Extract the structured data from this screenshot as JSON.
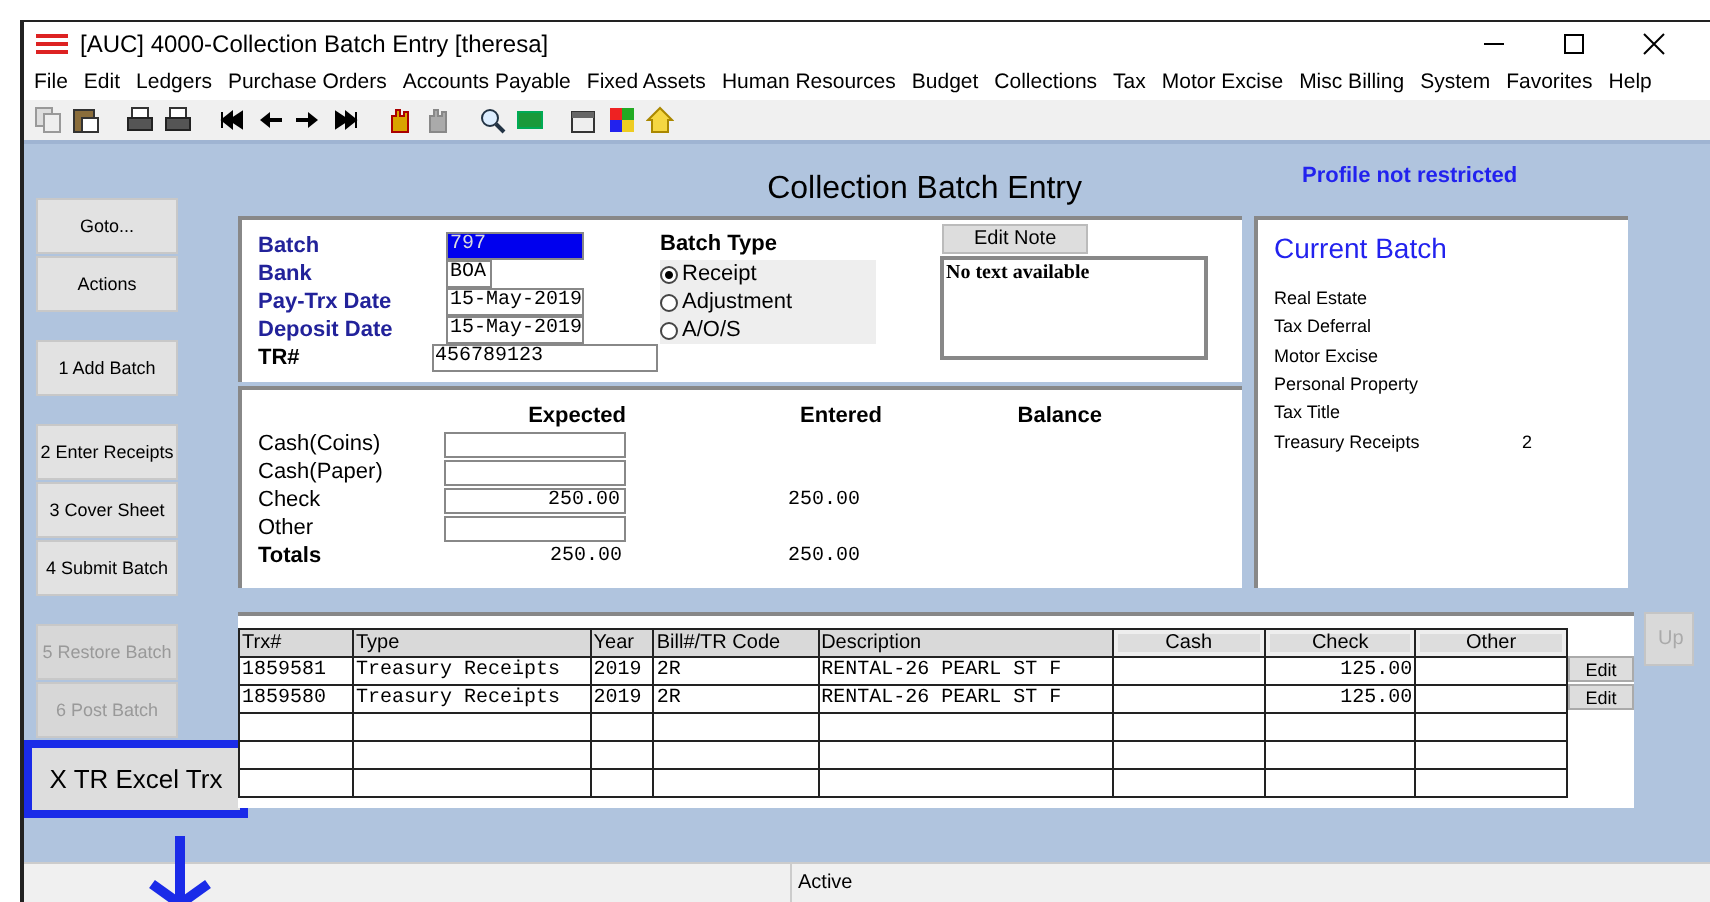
{
  "window": {
    "title": "[AUC] 4000-Collection Batch Entry [theresa]"
  },
  "menu": [
    "File",
    "Edit",
    "Ledgers",
    "Purchase Orders",
    "Accounts Payable",
    "Fixed Assets",
    "Human Resources",
    "Budget",
    "Collections",
    "Tax",
    "Motor Excise",
    "Misc Billing",
    "System",
    "Favorites",
    "Help"
  ],
  "header": {
    "title": "Collection Batch Entry",
    "profile": "Profile not restricted"
  },
  "left_buttons": [
    {
      "label": "Goto...",
      "disabled": false,
      "highlighted": false
    },
    {
      "label": "Actions",
      "disabled": false,
      "highlighted": false
    },
    {
      "label": "1 Add Batch",
      "disabled": false,
      "highlighted": false
    },
    {
      "label": "2 Enter Receipts",
      "disabled": false,
      "highlighted": false
    },
    {
      "label": "3 Cover Sheet",
      "disabled": false,
      "highlighted": false
    },
    {
      "label": "4 Submit Batch",
      "disabled": false,
      "highlighted": false
    },
    {
      "label": "5 Restore Batch",
      "disabled": true,
      "highlighted": false
    },
    {
      "label": "6 Post Batch",
      "disabled": true,
      "highlighted": false
    },
    {
      "label": "X TR Excel Trx",
      "disabled": false,
      "highlighted": true
    }
  ],
  "batch_fields": [
    {
      "label": "Batch",
      "value": "797",
      "focused": true,
      "kind": "short"
    },
    {
      "label": "Bank",
      "value": "BOA",
      "focused": false,
      "kind": "tiny"
    },
    {
      "label": "Pay-Trx Date",
      "value": "15-May-2019",
      "focused": false,
      "kind": "short"
    },
    {
      "label": "Deposit Date",
      "value": "15-May-2019",
      "focused": false,
      "kind": "short"
    },
    {
      "label": "TR#",
      "value": "456789123",
      "focused": false,
      "kind": "long"
    }
  ],
  "batch_type": {
    "label": "Batch Type",
    "options": [
      {
        "label": "Receipt",
        "selected": true
      },
      {
        "label": "Adjustment",
        "selected": false
      },
      {
        "label": "A/O/S",
        "selected": false
      }
    ]
  },
  "note": {
    "button": "Edit Note",
    "text": "No text available"
  },
  "amounts": {
    "columns": [
      "Expected",
      "Entered",
      "Balance"
    ],
    "rows": [
      {
        "label": "Cash(Coins)",
        "expected": "",
        "entered": "",
        "kind": "input"
      },
      {
        "label": "Cash(Paper)",
        "expected": "",
        "entered": "",
        "kind": "input"
      },
      {
        "label": "Check",
        "expected": "250.00",
        "entered": "250.00",
        "kind": "input"
      },
      {
        "label": "Other",
        "expected": "",
        "entered": "",
        "kind": "input"
      },
      {
        "label": "Totals",
        "expected": "250.00",
        "entered": "250.00",
        "kind": "total"
      }
    ]
  },
  "current_batch": {
    "title": "Current Batch",
    "items": [
      {
        "label": "Real Estate"
      },
      {
        "label": "Tax Deferral"
      },
      {
        "label": "Motor Excise"
      },
      {
        "label": "Personal Property"
      },
      {
        "label": "Tax Title"
      },
      {
        "label": "Treasury Receipts",
        "count": "2"
      }
    ]
  },
  "table": {
    "columns": [
      {
        "label": "Trx#",
        "kind": "plain"
      },
      {
        "label": "Type",
        "kind": "plain"
      },
      {
        "label": "Year",
        "kind": "plain"
      },
      {
        "label": "Bill#/TR Code",
        "kind": "plain"
      },
      {
        "label": "Description",
        "kind": "plain"
      },
      {
        "label": "Cash",
        "kind": "button"
      },
      {
        "label": "Check",
        "kind": "button"
      },
      {
        "label": "Other",
        "kind": "button"
      }
    ],
    "rows": [
      {
        "cells": [
          "1859581",
          "Treasury Receipts",
          "2019",
          "2R",
          "RENTAL-26 PEARL ST F",
          "",
          "125.00",
          ""
        ],
        "action": "Edit"
      },
      {
        "cells": [
          "1859580",
          "Treasury Receipts",
          "2019",
          "2R",
          "RENTAL-26 PEARL ST F",
          "",
          "125.00",
          ""
        ],
        "action": "Edit"
      }
    ]
  },
  "up_button": {
    "label": "Up",
    "disabled": true
  },
  "status_bar": {
    "text": "Active"
  }
}
